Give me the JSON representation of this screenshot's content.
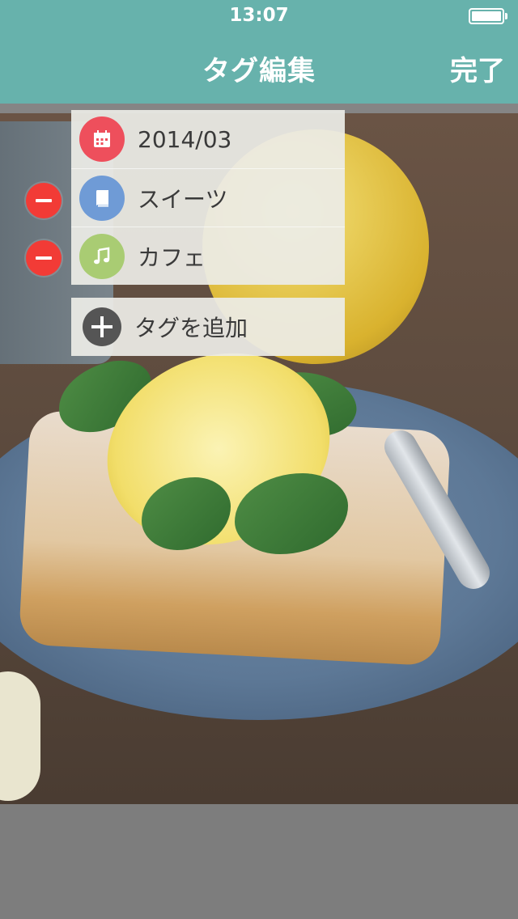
{
  "status_bar": {
    "time": "13:07"
  },
  "nav": {
    "title": "タグ編集",
    "done_label": "完了"
  },
  "tags": [
    {
      "label": "2014/03",
      "icon": "calendar-icon",
      "color": "#ee4f5c",
      "deletable": false
    },
    {
      "label": "スイーツ",
      "icon": "book-icon",
      "color": "#6f9bd6",
      "deletable": true
    },
    {
      "label": "カフェ",
      "icon": "music-note-icon",
      "color": "#a9cc73",
      "deletable": true
    }
  ],
  "add_tag": {
    "label": "タグを追加",
    "icon": "plus-icon"
  },
  "colors": {
    "header": "#67b2ac",
    "delete": "#f23b36",
    "add_icon": "#555555",
    "background": "#7d7d7d"
  }
}
